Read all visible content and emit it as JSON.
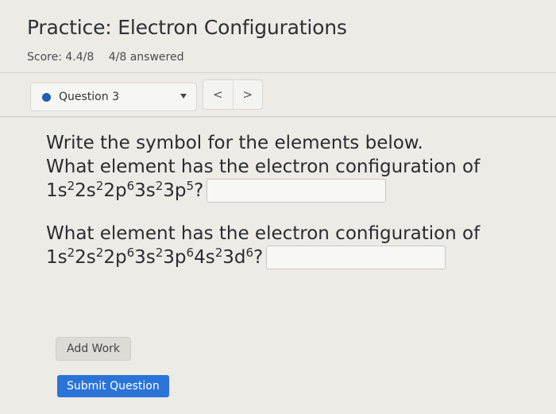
{
  "header": {
    "title": "Practice: Electron Configurations",
    "score": "Score: 4.4/8",
    "answered": "4/8 answered"
  },
  "question_nav": {
    "selected": "Question 3",
    "prev_glyph": "<",
    "next_glyph": ">"
  },
  "question": {
    "prompt": "Write the symbol for the elements below.",
    "parts": [
      {
        "text": "What element has the electron configuration of",
        "config": [
          {
            "base": "1s",
            "sup": "2"
          },
          {
            "base": "2s",
            "sup": "2"
          },
          {
            "base": "2p",
            "sup": "6"
          },
          {
            "base": "3s",
            "sup": "2"
          },
          {
            "base": "3p",
            "sup": "5"
          }
        ],
        "suffix": "?",
        "answer": ""
      },
      {
        "text": "What element has the electron configuration of",
        "config": [
          {
            "base": "1s",
            "sup": "2"
          },
          {
            "base": "2s",
            "sup": "2"
          },
          {
            "base": "2p",
            "sup": "6"
          },
          {
            "base": "3s",
            "sup": "2"
          },
          {
            "base": "3p",
            "sup": "6"
          },
          {
            "base": "4s",
            "sup": "2"
          },
          {
            "base": "3d",
            "sup": "6"
          }
        ],
        "suffix": "?",
        "answer": ""
      }
    ]
  },
  "actions": {
    "add_work": "Add Work",
    "submit": "Submit Question"
  },
  "colors": {
    "accent": "#2a74d8",
    "selected_dot": "#1f5fb0",
    "background": "#ecebe6"
  }
}
